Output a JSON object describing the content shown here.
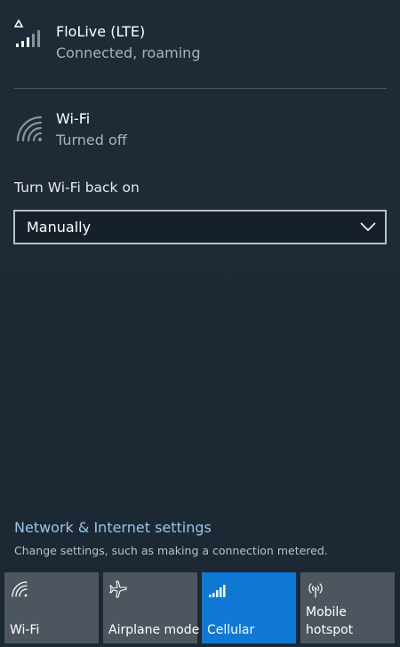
{
  "networks": [
    {
      "name": "FloLive (LTE)",
      "status": "Connected, roaming",
      "icon": "cellular-roaming-icon"
    },
    {
      "name": "Wi-Fi",
      "status": "Turned off",
      "icon": "wifi-off-icon"
    }
  ],
  "wifi_settings": {
    "turn_on_label": "Turn Wi-Fi back on",
    "turn_on_selected": "Manually"
  },
  "footer": {
    "settings_link": "Network & Internet settings",
    "settings_description": "Change settings, such as making a connection metered."
  },
  "quick_actions": [
    {
      "label": "Wi-Fi",
      "icon": "wifi-icon",
      "active": false
    },
    {
      "label": "Airplane mode",
      "icon": "airplane-icon",
      "active": false
    },
    {
      "label": "Cellular",
      "icon": "cellular-icon",
      "active": true
    },
    {
      "label_line1": "Mobile",
      "label_line2": "hotspot",
      "icon": "mobile-hotspot-icon",
      "active": false
    }
  ],
  "colors": {
    "background": "#1f2b36",
    "accent": "#0f78d4",
    "tile_inactive": "#4d565e",
    "link": "#9ac4ea"
  }
}
